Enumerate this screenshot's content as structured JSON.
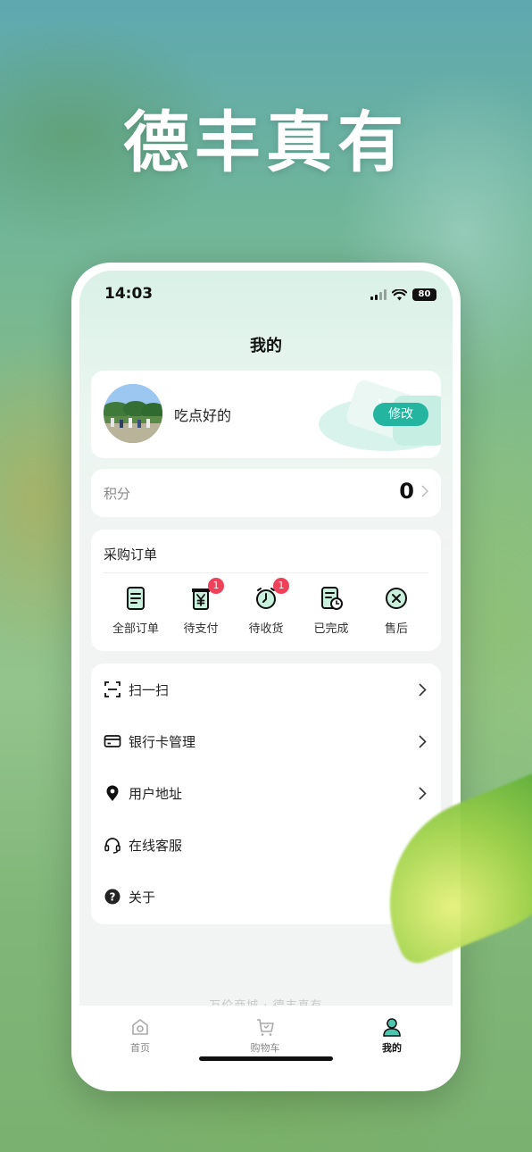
{
  "hero": {
    "title": "德丰真有"
  },
  "status_bar": {
    "time": "14:03",
    "battery": "80"
  },
  "header": {
    "title": "我的"
  },
  "profile": {
    "name": "吃点好的",
    "edit_label": "修改"
  },
  "points": {
    "label": "积分",
    "value": "0"
  },
  "orders": {
    "title": "采购订单",
    "items": [
      {
        "label": "全部订单",
        "icon": "document-list-icon",
        "badge": ""
      },
      {
        "label": "待支付",
        "icon": "yuan-receipt-icon",
        "badge": "1"
      },
      {
        "label": "待收货",
        "icon": "clock-icon",
        "badge": "1"
      },
      {
        "label": "已完成",
        "icon": "document-check-icon",
        "badge": ""
      },
      {
        "label": "售后",
        "icon": "close-circle-icon",
        "badge": ""
      }
    ]
  },
  "menu": {
    "items": [
      {
        "label": "扫一扫",
        "icon": "scan-icon"
      },
      {
        "label": "银行卡管理",
        "icon": "bank-card-icon"
      },
      {
        "label": "用户地址",
        "icon": "location-pin-icon"
      },
      {
        "label": "在线客服",
        "icon": "headset-icon"
      },
      {
        "label": "关于",
        "icon": "question-circle-icon"
      }
    ]
  },
  "footer_hint": "———— 万价商城 · 德丰真有 ————",
  "tabbar": {
    "items": [
      {
        "label": "首页",
        "icon": "home-icon"
      },
      {
        "label": "购物车",
        "icon": "cart-icon"
      },
      {
        "label": "我的",
        "icon": "user-icon"
      }
    ]
  },
  "colors": {
    "accent": "#24b5a0",
    "badge": "#f0415a",
    "icon_fill": "#c9f0dc"
  }
}
